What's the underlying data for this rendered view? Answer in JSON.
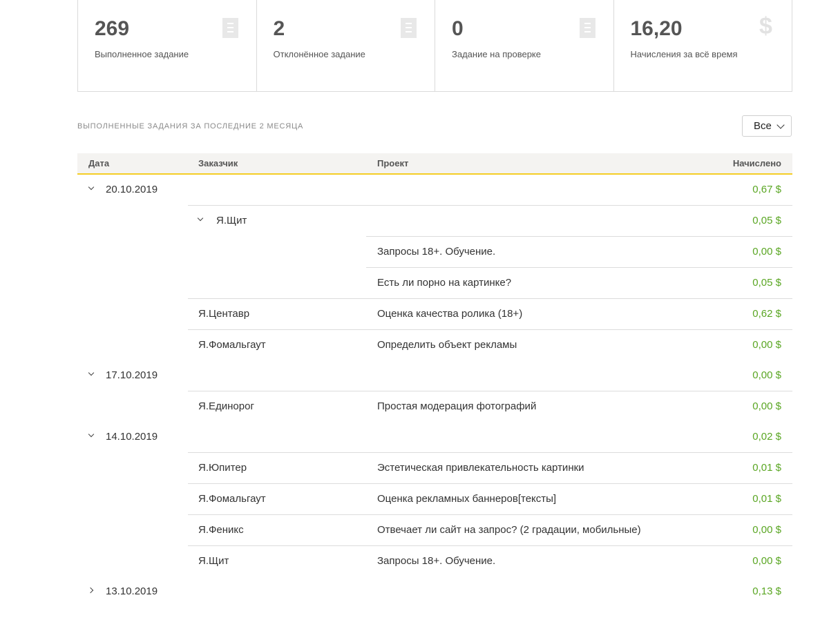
{
  "stats": [
    {
      "value": "269",
      "label": "Выполненное задание",
      "icon": "document-icon"
    },
    {
      "value": "2",
      "label": "Отклонённое задание",
      "icon": "document-icon"
    },
    {
      "value": "0",
      "label": "Задание на проверке",
      "icon": "document-icon"
    },
    {
      "value": "16,20",
      "label": "Начисления за всё время",
      "icon": "dollar-icon"
    }
  ],
  "section_title": "ВЫПОЛНЕННЫЕ ЗАДАНИЯ ЗА ПОСЛЕДНИЕ 2 МЕСЯЦА",
  "filter": {
    "selected": "Все"
  },
  "table": {
    "headers": {
      "date": "Дата",
      "customer": "Заказчик",
      "project": "Проект",
      "amount": "Начислено"
    },
    "rows": [
      {
        "type": "date",
        "date": "20.10.2019",
        "amount": "0,67 $",
        "expanded": true
      },
      {
        "type": "customer-group",
        "customer": "Я.Щит",
        "amount": "0,05 $",
        "expanded": true
      },
      {
        "type": "project",
        "project": "Запросы 18+. Обучение.",
        "amount": "0,00 $"
      },
      {
        "type": "project",
        "project": "Есть ли порно на картинке?",
        "amount": "0,05 $"
      },
      {
        "type": "entry",
        "customer": "Я.Центавр",
        "project": "Оценка качества ролика (18+)",
        "amount": "0,62 $"
      },
      {
        "type": "entry",
        "customer": "Я.Фомальгаут",
        "project": "Определить объект рекламы",
        "amount": "0,00 $"
      },
      {
        "type": "date",
        "date": "17.10.2019",
        "amount": "0,00 $",
        "expanded": true
      },
      {
        "type": "entry",
        "customer": "Я.Единорог",
        "project": "Простая модерация фотографий",
        "amount": "0,00 $"
      },
      {
        "type": "date",
        "date": "14.10.2019",
        "amount": "0,02 $",
        "expanded": true
      },
      {
        "type": "entry",
        "customer": "Я.Юпитер",
        "project": "Эстетическая привлекательность картинки",
        "amount": "0,01 $"
      },
      {
        "type": "entry",
        "customer": "Я.Фомальгаут",
        "project": "Оценка рекламных баннеров[тексты]",
        "amount": "0,01 $"
      },
      {
        "type": "entry",
        "customer": "Я.Феникс",
        "project": "Отвечает ли сайт на запрос? (2 градации, мобильные)",
        "amount": "0,00 $"
      },
      {
        "type": "entry",
        "customer": "Я.Щит",
        "project": "Запросы 18+. Обучение.",
        "amount": "0,00 $"
      },
      {
        "type": "date",
        "date": "13.10.2019",
        "amount": "0,13 $",
        "expanded": false
      }
    ]
  },
  "colors": {
    "accent": "#f5cd25",
    "amount": "#5aa623"
  }
}
